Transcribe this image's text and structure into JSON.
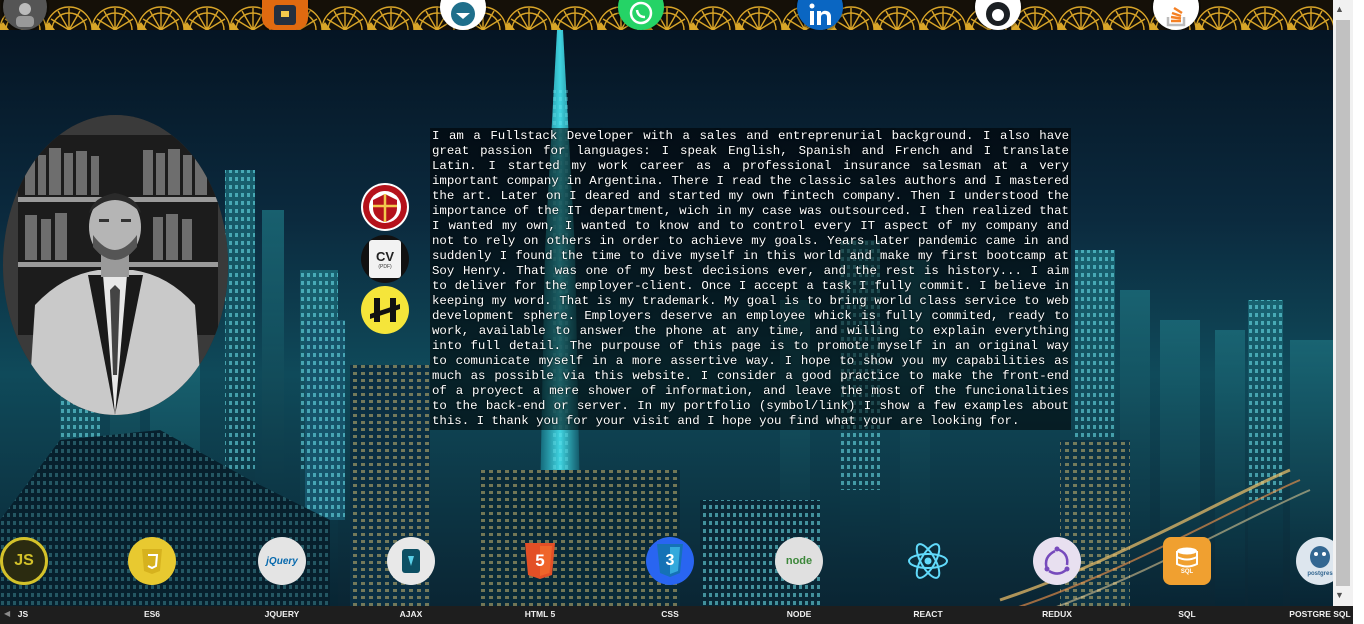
{
  "top_bar": {
    "icons": [
      {
        "name": "profile-thumbnail-icon",
        "color": "#555555"
      },
      {
        "name": "portfolio-icon",
        "color": "#e06a10"
      },
      {
        "name": "email-icon",
        "color": "#ffffff"
      },
      {
        "name": "whatsapp-icon",
        "color": "#25d366"
      },
      {
        "name": "linkedin-icon",
        "color": "#0a66c2"
      },
      {
        "name": "github-icon",
        "color": "#ffffff"
      },
      {
        "name": "stackoverflow-icon",
        "color": "#ffffff"
      }
    ]
  },
  "side_badges": {
    "cv_label": "CV",
    "cv_sub": "(PDF)",
    "icons": [
      "university-crest-icon",
      "cv-pdf-icon",
      "henry-bootcamp-icon"
    ]
  },
  "bio": {
    "text": "I am a Fullstack Developer with a sales and entreprenurial background. I also have great passion for languages: I speak English, Spanish and French and I translate Latin. I started my work career as a professional insurance salesman at a very important company in Argentina. There I read the classic sales authors and I mastered the art. Later on I deared and started my own fintech company. Then I understood the importance of the IT department, wich in my case was outsourced. I then realized that I wanted my own, I wanted to know and to control every IT aspect of my company and not to rely on others in order to achieve my goals. Years later pandemic came in and suddenly I found the time to dive myself in this world and make my first bootcamp at Soy Henry. That was one of my best decisions ever, and the rest is history... I aim to deliver for the employer-client. Once I accept a task I fully commit. I believe in keeping my word. That is my trademark. My goal is to bring world class service to web development sphere. Employers deserve an employee whick is fully commited, ready to work, available to answer the phone at any time, and willing to explain everything into full detail. The purpouse of this page is to promote myself in an original way to comunicate myself in a more assertive way. I hope to show you my capabilities as much as possible via this website. I consider a good practice to make the front-end of a proyect a mere shower of information, and leave the most of the funcionalities to the back-end or server. In my portfolio (symbol/link) I show a few examples about this. I thank you for your visit and I hope you find what your are looking for."
  },
  "tech_icon_text": {
    "js": "JS",
    "jquery": "jQuery",
    "html5": "5",
    "css3": "3",
    "node": "node",
    "sql": "SQL",
    "postgres": "postgres"
  },
  "techs": [
    {
      "label": "JS",
      "icon": "javascript-icon",
      "color": "#d4c22a"
    },
    {
      "label": "ES6",
      "icon": "es6-icon",
      "color": "#e8c930"
    },
    {
      "label": "JQUERY",
      "icon": "jquery-icon",
      "color": "#e4e4e4"
    },
    {
      "label": "AJAX",
      "icon": "ajax-icon",
      "color": "#e8e8e8"
    },
    {
      "label": "HTML 5",
      "icon": "html5-icon",
      "color": "#e34f26"
    },
    {
      "label": "CSS",
      "icon": "css3-icon",
      "color": "#2965f1"
    },
    {
      "label": "NODE",
      "icon": "nodejs-icon",
      "color": "#e0e0e0"
    },
    {
      "label": "REACT",
      "icon": "react-icon",
      "color": "#61dafb"
    },
    {
      "label": "REDUX",
      "icon": "redux-icon",
      "color": "#e8e0f0"
    },
    {
      "label": "SQL",
      "icon": "sql-icon",
      "color": "#f0a030"
    },
    {
      "label": "POSTGRE SQL",
      "icon": "postgresql-icon",
      "color": "#dde6ee"
    }
  ]
}
